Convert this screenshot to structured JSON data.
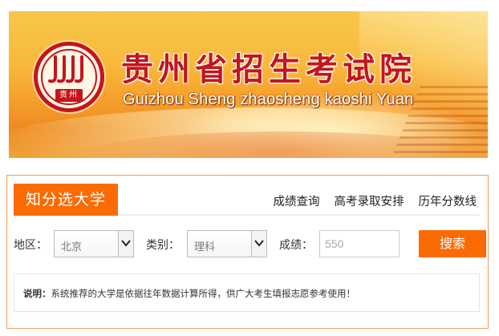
{
  "header": {
    "title": "贵州省招生考试院",
    "subtitle": "Guizhou Sheng zhaosheng kaoshi Yuan",
    "logo_seal_text": "贵州"
  },
  "panel": {
    "title": "知分选大学",
    "links": [
      "成绩查询",
      "高考录取安排",
      "历年分数线"
    ]
  },
  "form": {
    "region_label": "地区：",
    "region_value": "北京",
    "category_label": "类别：",
    "category_value": "理科",
    "score_label": "成绩：",
    "score_placeholder": "550",
    "search_label": "搜索"
  },
  "note": {
    "label": "说明：",
    "text": "系统推荐的大学是依据往年数据计算所得，供广大考生填报志愿参考使用！"
  },
  "colors": {
    "accent": "#fb6b03",
    "brand_red": "#c4151c",
    "panel_border": "#f0a060"
  }
}
